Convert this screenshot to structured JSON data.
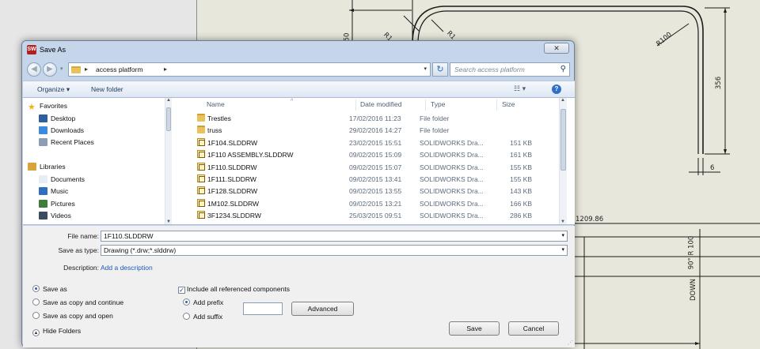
{
  "cad": {
    "dim_50": "50",
    "dim_r_a": "R1",
    "dim_r_b": "R1",
    "dim_r100": "R100",
    "dim_356": "356",
    "dim_6": "6",
    "dim_1209": "1209.86",
    "note_down": "DOWN",
    "note_90r100": "90° R 100"
  },
  "dialog": {
    "title": "Save As",
    "app_icon_text": "SW",
    "close_label": "✕",
    "address": {
      "crumb": "access platform",
      "separator": "▸",
      "dropdown": "▾",
      "refresh": "↻"
    },
    "search": {
      "placeholder": "Search access platform"
    },
    "toolbar": {
      "organize": "Organize ▾",
      "new_folder": "New folder",
      "view": "☷ ▾",
      "help": "?"
    },
    "nav": [
      {
        "label": "Favorites",
        "group": true,
        "icon": "star-icon",
        "color": "#f2b01e"
      },
      {
        "label": "Desktop",
        "icon": "desktop-icon",
        "color": "#2f5d9e"
      },
      {
        "label": "Downloads",
        "icon": "downloads-icon",
        "color": "#3c8adf"
      },
      {
        "label": "Recent Places",
        "icon": "recent-places-icon",
        "color": "#8a9db4"
      },
      {
        "label": "Libraries",
        "group": true,
        "icon": "libraries-icon",
        "color": "#d9a43a"
      },
      {
        "label": "Documents",
        "icon": "documents-icon",
        "color": "#e7edf5"
      },
      {
        "label": "Music",
        "icon": "music-icon",
        "color": "#2f6fbd"
      },
      {
        "label": "Pictures",
        "icon": "pictures-icon",
        "color": "#3e7d3a"
      },
      {
        "label": "Videos",
        "icon": "videos-icon",
        "color": "#3b4a5f"
      }
    ],
    "columns": {
      "name": "Name",
      "date": "Date modified",
      "type": "Type",
      "size": "Size"
    },
    "files": [
      {
        "name": "Trestles",
        "date": "17/02/2016 11:23",
        "type": "File folder",
        "size": "",
        "kind": "folder"
      },
      {
        "name": "truss",
        "date": "29/02/2016 14:27",
        "type": "File folder",
        "size": "",
        "kind": "folder"
      },
      {
        "name": "1F104.SLDDRW",
        "date": "23/02/2015 15:51",
        "type": "SOLIDWORKS Dra...",
        "size": "151 KB",
        "kind": "draw"
      },
      {
        "name": "1F110 ASSEMBLY.SLDDRW",
        "date": "09/02/2015 15:09",
        "type": "SOLIDWORKS Dra...",
        "size": "161 KB",
        "kind": "draw"
      },
      {
        "name": "1F110.SLDDRW",
        "date": "09/02/2015 15:07",
        "type": "SOLIDWORKS Dra...",
        "size": "155 KB",
        "kind": "draw"
      },
      {
        "name": "1F111.SLDDRW",
        "date": "09/02/2015 13:41",
        "type": "SOLIDWORKS Dra...",
        "size": "155 KB",
        "kind": "draw"
      },
      {
        "name": "1F128.SLDDRW",
        "date": "09/02/2015 13:55",
        "type": "SOLIDWORKS Dra...",
        "size": "143 KB",
        "kind": "draw"
      },
      {
        "name": "1M102.SLDDRW",
        "date": "09/02/2015 13:21",
        "type": "SOLIDWORKS Dra...",
        "size": "166 KB",
        "kind": "draw"
      },
      {
        "name": "3F1234.SLDDRW",
        "date": "25/03/2015 09:51",
        "type": "SOLIDWORKS Dra...",
        "size": "286 KB",
        "kind": "draw"
      }
    ],
    "form": {
      "file_name_label": "File name:",
      "file_name_value": "1F110.SLDDRW",
      "save_type_label": "Save as type:",
      "save_type_value": "Drawing (*.drw;*.slddrw)",
      "description_label": "Description:",
      "description_link": "Add a description",
      "dropdown_arrow": "▾"
    },
    "options": {
      "save_as": "Save as",
      "save_as_copy_continue": "Save as copy and continue",
      "save_as_copy_open": "Save as copy and open",
      "include_refs": "Include all referenced components",
      "add_prefix": "Add prefix",
      "add_suffix": "Add suffix",
      "advanced": "Advanced",
      "selected_mode": "Save as",
      "include_refs_checked": true,
      "affix_selected": "Add prefix"
    },
    "buttons": {
      "hide_folders": "Hide Folders",
      "save": "Save",
      "cancel": "Cancel"
    }
  }
}
